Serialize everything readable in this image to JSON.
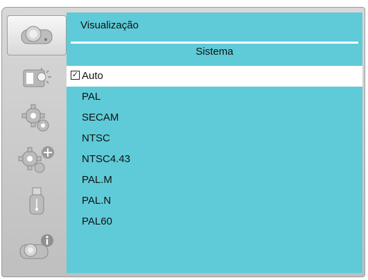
{
  "breadcrumb": "Visualização",
  "section_title": "Sistema",
  "menu": {
    "items": [
      {
        "label": "Auto",
        "checked": true
      },
      {
        "label": "PAL"
      },
      {
        "label": "SECAM"
      },
      {
        "label": "NTSC"
      },
      {
        "label": "NTSC4.43"
      },
      {
        "label": "PAL.M"
      },
      {
        "label": "PAL.N"
      },
      {
        "label": "PAL60"
      }
    ],
    "check_mark": "✓"
  },
  "sidebar": {
    "items": [
      {
        "icon": "projector-icon",
        "active": true
      },
      {
        "icon": "picture-brightness-icon"
      },
      {
        "icon": "gear-icon"
      },
      {
        "icon": "advanced-settings-icon"
      },
      {
        "icon": "usb-icon"
      },
      {
        "icon": "projector-info-icon"
      }
    ]
  },
  "colors": {
    "panel": "#5fcbd8",
    "selected_row": "#ffffff",
    "icon": "#a9a9a9"
  }
}
